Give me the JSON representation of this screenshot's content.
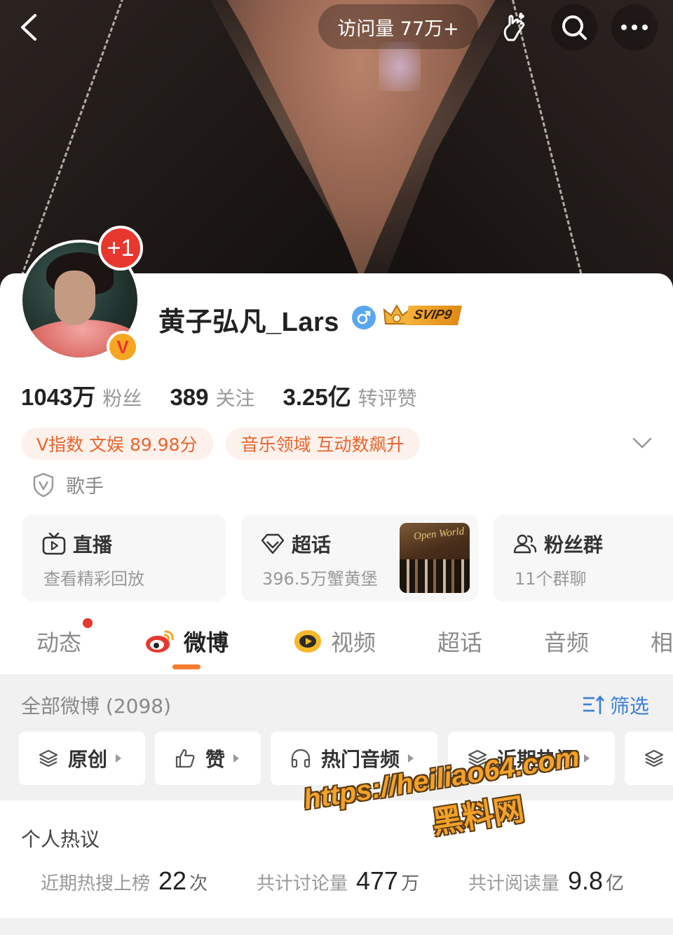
{
  "header": {
    "visit_count": "访问量 77万+"
  },
  "profile": {
    "username": "黄子弘凡_Lars",
    "plus_badge": "+1",
    "verified_badge": "V",
    "svip_label": "SVIP9",
    "stats": [
      {
        "value": "1043万",
        "label": "粉丝"
      },
      {
        "value": "389",
        "label": "关注"
      },
      {
        "value": "3.25亿",
        "label": "转评赞"
      }
    ],
    "tags": [
      "V指数 文娱 89.98分",
      "音乐领域 互动数飙升"
    ],
    "role": "歌手"
  },
  "features": {
    "live": {
      "title": "直播",
      "subtitle": "查看精彩回放"
    },
    "topic": {
      "title": "超话",
      "subtitle": "396.5万蟹黄堡",
      "thumb_text": "Open World"
    },
    "fans": {
      "title": "粉丝群",
      "subtitle": "11个群聊"
    }
  },
  "tabs": [
    "动态",
    "微博",
    "视频",
    "超话",
    "音频",
    "相"
  ],
  "active_tab": "微博",
  "filter": {
    "all_count": "全部微博 (2098)",
    "filter_label": "筛选",
    "chips": [
      "原创",
      "赞",
      "热门音频",
      "近期热门",
      ""
    ]
  },
  "hot": {
    "title": "个人热议",
    "stats": [
      {
        "label": "近期热搜上榜",
        "value": "22",
        "unit": "次"
      },
      {
        "label": "共计讨论量",
        "value": "477",
        "unit": "万"
      },
      {
        "label": "共计阅读量",
        "value": "9.8",
        "unit": "亿"
      }
    ]
  },
  "watermark": {
    "url": "https://heiliao64.com",
    "name": "黑料网"
  },
  "colors": {
    "accent_orange": "#f47c2c",
    "tag_text": "#e8652e",
    "tag_bg": "#fdf1ec",
    "link_blue": "#3c7fd6",
    "badge_red": "#e8372e"
  }
}
